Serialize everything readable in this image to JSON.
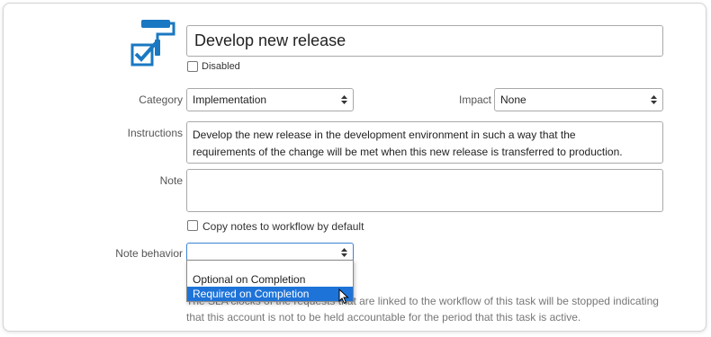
{
  "task": {
    "title": "Develop new release",
    "disabled_label": "Disabled"
  },
  "fields": {
    "category_label": "Category",
    "category_value": "Implementation",
    "impact_label": "Impact",
    "impact_value": "None",
    "instructions_label": "Instructions",
    "instructions_line1": "Develop the new release in the development environment in such a way that the",
    "instructions_line2": "requirements of the change will be met when this new release is transferred to production.",
    "note_label": "Note",
    "note_value": "",
    "copy_notes_label": "Copy notes to workflow by default",
    "note_behavior_label": "Note behavior",
    "note_behavior_value": ""
  },
  "dropdown": {
    "options": [
      "Optional on Completion",
      "Required on Completion"
    ],
    "highlighted": "Required on Completion"
  },
  "help": {
    "line1_visible": "The SLA clocks of the requests that are linked to the workflow of this task will be stopped indicating",
    "line2": "that this account is not to be held accountable for the period that this task is active."
  },
  "colors": {
    "icon_blue": "#1a78c2",
    "highlight": "#1e73d8"
  },
  "icons": [
    "paint-roller-checkbox-icon",
    "select-arrows-icon",
    "mouse-cursor-icon"
  ]
}
